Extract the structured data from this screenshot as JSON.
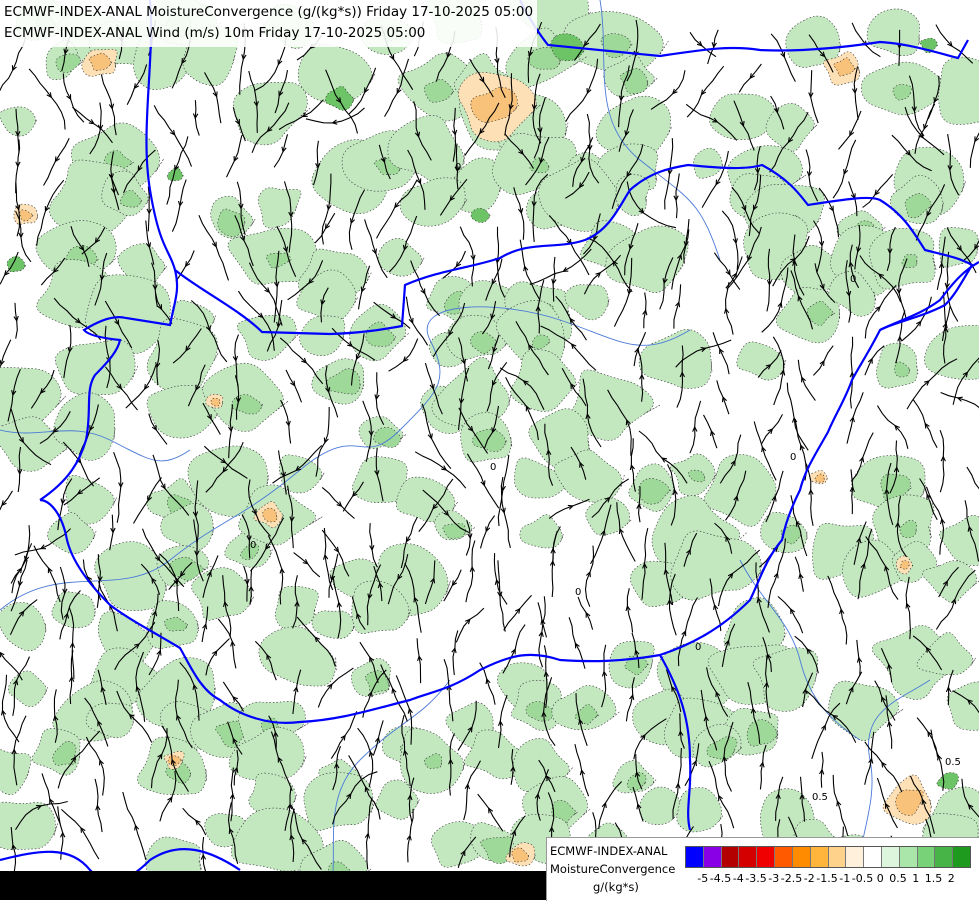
{
  "title": {
    "line1": "ECMWF-INDEX-ANAL MoistureConvergence (g/(kg*s)) Friday 17-10-2025 05:00",
    "line2": "ECMWF-INDEX-ANAL Wind (m/s) 10m Friday 17-10-2025 05:00"
  },
  "legend": {
    "source": "ECMWF-INDEX-ANAL",
    "parameter": "MoistureConvergence",
    "unit": "g/(kg*s)",
    "colors": [
      "#0000ff",
      "#8a00e6",
      "#b30000",
      "#d40000",
      "#f00000",
      "#ff5a00",
      "#ff8c00",
      "#ffb43c",
      "#ffd28c",
      "#fff0dc",
      "#ffffff",
      "#dcf5dc",
      "#aae6aa",
      "#78d278",
      "#46b446",
      "#1e9b1e"
    ],
    "ticks": [
      "-5",
      "-4.5",
      "-4",
      "-3.5",
      "-3",
      "-2.5",
      "-2",
      "-1.5",
      "-1",
      "-0.5",
      "0",
      "0.5",
      "1",
      "1.5",
      "2"
    ]
  },
  "map": {
    "colors": {
      "background": "#ffffff",
      "convergence_light": "#c3e8c0",
      "convergence_mid": "#9fd99a",
      "convergence_strong": "#6cc466",
      "divergence_light": "#fde0b5",
      "divergence_mid": "#f9c27a",
      "streamline": "#000000",
      "border": "#0000ff",
      "river": "#4a7ad8"
    },
    "contour_labels": [
      "0",
      "0",
      "0",
      "0",
      "0",
      "0",
      "0",
      "0.5",
      "0.5"
    ]
  }
}
